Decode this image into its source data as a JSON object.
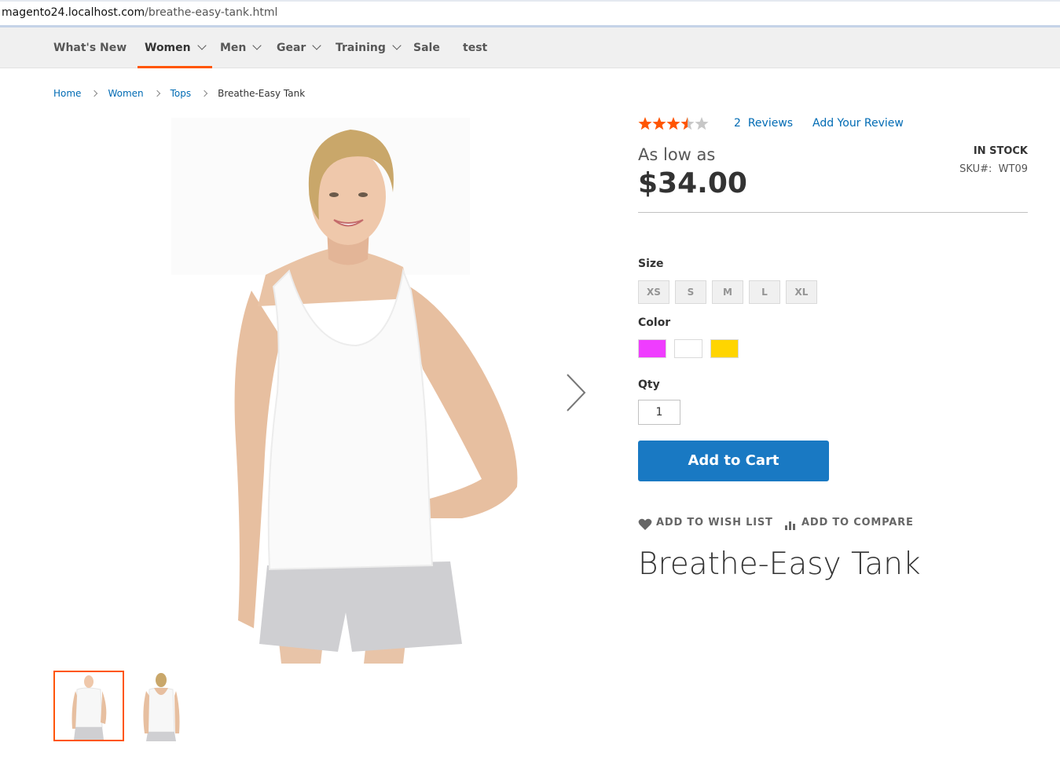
{
  "browser": {
    "url_host": "magento24.localhost.com",
    "url_path": "/breathe-easy-tank.html"
  },
  "nav": {
    "items": [
      {
        "label": "What's New",
        "has_dropdown": false
      },
      {
        "label": "Women",
        "has_dropdown": true,
        "active": true
      },
      {
        "label": "Men",
        "has_dropdown": true
      },
      {
        "label": "Gear",
        "has_dropdown": true
      },
      {
        "label": "Training",
        "has_dropdown": true
      },
      {
        "label": "Sale",
        "has_dropdown": false
      },
      {
        "label": "test",
        "has_dropdown": false
      }
    ],
    "active_color": "#ff5501"
  },
  "breadcrumbs": {
    "home": "Home",
    "women": "Women",
    "tops": "Tops",
    "current": "Breathe-Easy Tank"
  },
  "product": {
    "name": "Breathe-Easy Tank",
    "rating": 3.5,
    "rating_max": 5,
    "reviews_count": "2",
    "reviews_label": "Reviews",
    "add_review_label": "Add Your Review",
    "price_prefix": "As low as",
    "price": "$34.00",
    "stock": "IN STOCK",
    "sku_label": "SKU#:",
    "sku": "WT09",
    "size_label": "Size",
    "sizes": [
      "XS",
      "S",
      "M",
      "L",
      "XL"
    ],
    "color_label": "Color",
    "colors": [
      {
        "name": "Purple",
        "hex": "#ef3dff"
      },
      {
        "name": "White",
        "hex": "#ffffff"
      },
      {
        "name": "Yellow",
        "hex": "#ffd500"
      }
    ],
    "qty_label": "Qty",
    "qty_value": "1",
    "add_to_cart_label": "Add to Cart",
    "wishlist_label": "ADD TO WISH LIST",
    "compare_label": "ADD TO COMPARE",
    "accent_blue": "#1979c3",
    "star_color": "#ff5501"
  },
  "gallery": {
    "thumbnail_count": 2,
    "active_thumbnail": 1
  }
}
